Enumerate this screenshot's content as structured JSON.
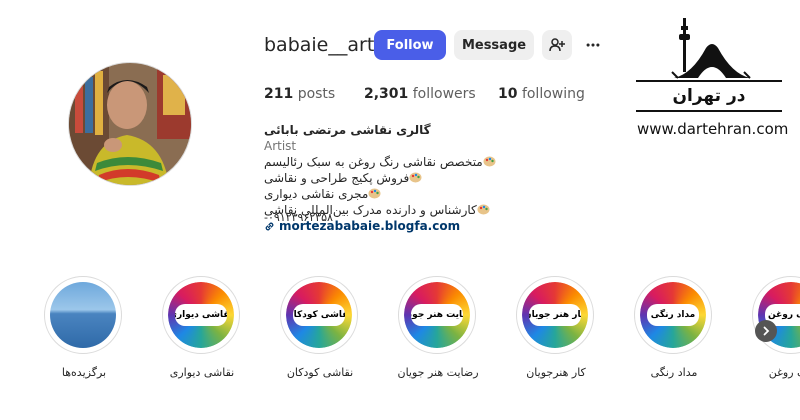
{
  "profile": {
    "username": "babaie__art",
    "follow_label": "Follow",
    "message_label": "Message",
    "posts_count": "211",
    "posts_label": "posts",
    "followers_count": "2,301",
    "followers_label": "followers",
    "following_count": "10",
    "following_label": "following"
  },
  "bio": {
    "name": "گالری نقاشی مرتضی بابائی",
    "category": "Artist",
    "lines": [
      "متخصص نقاشی رنگ روغن به سبک رئالیسم",
      "فروش پکیج طراحی و نقاشی",
      "مجری نقاشی دیواری",
      "کارشناس و دارنده مدرک بین‌المللی نقاشی",
      "-۰۹۱۲۳۹۶۲۳۵۸"
    ],
    "link": "mortezababaie.blogfa.com"
  },
  "watermark": {
    "fa_text": "در تهران",
    "url": "www.dartehran.com"
  },
  "highlights": [
    {
      "label": "برگزیده‌ها",
      "badge": ""
    },
    {
      "label": "نقاشی دیواری",
      "badge": "نقاشی دیواری"
    },
    {
      "label": "نقاشی کودکان",
      "badge": "نقاشی کودکان"
    },
    {
      "label": "رضایت هنر جویان",
      "badge": "رضایت هنر جویان"
    },
    {
      "label": "کار هنرجویان",
      "badge": "کار هنر جویان"
    },
    {
      "label": "مداد رنگی",
      "badge": "مداد رنگی"
    },
    {
      "label": "رنگ روغن",
      "badge": "رنگ روغن"
    }
  ],
  "icons": {
    "add_user": "add-user-icon",
    "more": "more-options-icon",
    "link": "link-icon",
    "palette": "palette-icon",
    "next": "chevron-right-icon"
  },
  "colors": {
    "follow_button": "#4a5ee8",
    "secondary_button": "#efefef",
    "link": "#00376b"
  }
}
